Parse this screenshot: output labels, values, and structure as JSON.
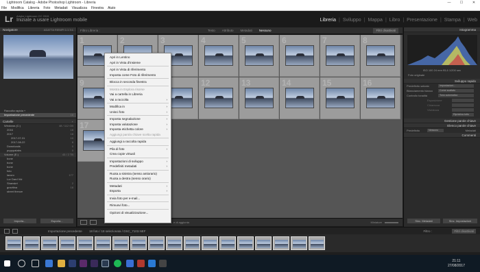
{
  "window": {
    "title": "Lightroom Catalog - Adobe Photoshop Lightroom - Libreria",
    "controls": [
      "—",
      "☐",
      "✕"
    ]
  },
  "menu": [
    "File",
    "Modifica",
    "Libreria",
    "Foto",
    "Metadati",
    "Visualizza",
    "Finestra",
    "Aiuto"
  ],
  "identity": {
    "logo": "Lr",
    "catalog": "Adobe Lightroom CC 2015",
    "subtitle": "Iniziate a usare Lightroom mobile"
  },
  "modules": [
    "Libreria",
    "Sviluppo",
    "Mappa",
    "Libro",
    "Presentazione",
    "Stampa",
    "Web"
  ],
  "left_panel": {
    "navigator_label": "Navigatore",
    "navigator_modes": "ADATTA  RIEMPI  1:1  3:1",
    "quick_collection": "Raccolta rapida +",
    "previous_import": "Importazione precedente",
    "previous_import_count": "18",
    "catalog_label": "Cartelle",
    "volume1": "Windows (C:)",
    "volume1_info": "48 / 112 GB",
    "tree": [
      {
        "label": "2016",
        "count": "18"
      },
      {
        "label": "2017",
        "count": "18"
      },
      {
        "label": "2017-07-31",
        "count": "10"
      },
      {
        "label": "2017-08-22",
        "count": "8"
      },
      {
        "label": "Downloads",
        "count": "0"
      },
      {
        "label": "pupppatabs",
        "count": "0"
      }
    ],
    "volume2": "Volume (E:)",
    "volume2_info": "43 / 2 TB",
    "tree2": [
      {
        "label": "bone",
        "count": ""
      },
      {
        "label": "bone",
        "count": ""
      },
      {
        "label": "bone",
        "count": ""
      },
      {
        "label": "foto",
        "count": ""
      },
      {
        "label": "lavoro",
        "count": "177"
      },
      {
        "label": "Lor Dard Vid",
        "count": ""
      },
      {
        "label": "Shanskrt",
        "count": "2"
      },
      {
        "label": "gravitina",
        "count": "18"
      },
      {
        "label": "street firenze",
        "count": ""
      }
    ],
    "import_btn": "Importa...",
    "export_btn": "Esporta..."
  },
  "filterbar": {
    "label": "Filtro Libreria :",
    "tabs": [
      "Testo",
      "Attributo",
      "Metadati",
      "Nessuno"
    ],
    "active_tab": "Nessuno",
    "preset": "Filtri disattivati"
  },
  "grid": {
    "row1": [
      "1",
      "2",
      "3",
      "4",
      "5",
      "6",
      "7",
      "8"
    ],
    "row2": [
      "9",
      "10",
      "11",
      "12",
      "13",
      "14",
      "15",
      "16"
    ],
    "row3": [
      "17"
    ]
  },
  "toolbar": {
    "sort": "Ordina: Ora di acquisizione",
    "thumbs": "Miniature",
    "note": "e di aggiunta"
  },
  "context_menu": [
    {
      "label": "Apri in Lentino",
      "type": "item"
    },
    {
      "label": "Apri in Vista d'insieme",
      "type": "item"
    },
    {
      "type": "sep"
    },
    {
      "label": "Apri in Vista di riferimento",
      "type": "item"
    },
    {
      "label": "Imposta come Foto di riferimento",
      "type": "item"
    },
    {
      "type": "sep"
    },
    {
      "label": "Blocca in seconda finestra",
      "type": "item"
    },
    {
      "type": "sep"
    },
    {
      "label": "Mostra in Esplora risorse",
      "type": "disabled"
    },
    {
      "label": "Vai a cartella in Libreria",
      "type": "item"
    },
    {
      "label": "Vai a raccolta",
      "type": "sub"
    },
    {
      "type": "sep"
    },
    {
      "label": "Modifica in",
      "type": "sub"
    },
    {
      "label": "Unisci foto",
      "type": "sub"
    },
    {
      "type": "sep"
    },
    {
      "label": "Imposta segnalazione",
      "type": "sub"
    },
    {
      "label": "Imposta valutazione",
      "type": "sub"
    },
    {
      "label": "Imposta etichetta colore",
      "type": "sub"
    },
    {
      "label": "Aggiungi parola chiave scelta rapida",
      "type": "disabled"
    },
    {
      "type": "sep"
    },
    {
      "label": "Aggiungi a raccolta rapida",
      "type": "item"
    },
    {
      "type": "sep"
    },
    {
      "label": "Pila di foto",
      "type": "sub"
    },
    {
      "label": "Crea copie virtuali",
      "type": "item"
    },
    {
      "type": "sep"
    },
    {
      "label": "Impostazioni di sviluppo",
      "type": "sub"
    },
    {
      "label": "Predefiniti metadati",
      "type": "sub"
    },
    {
      "type": "sep"
    },
    {
      "label": "Ruota a sinistra (senso antiorario)",
      "type": "item"
    },
    {
      "label": "Ruota a destra (senso orario)",
      "type": "item"
    },
    {
      "type": "sep"
    },
    {
      "label": "Metadati",
      "type": "sub"
    },
    {
      "label": "Esporta",
      "type": "sub"
    },
    {
      "type": "sep"
    },
    {
      "label": "Invia foto per e-mail...",
      "type": "item"
    },
    {
      "type": "sep"
    },
    {
      "label": "Rimuovi foto...",
      "type": "item"
    },
    {
      "type": "sep"
    },
    {
      "label": "Opzioni di visualizzazione...",
      "type": "item"
    }
  ],
  "right_panel": {
    "histogram_label": "Istogramma",
    "histo_info": "ISO 100   24 mm   f/5,6   1/200 sec",
    "original": "Foto originale",
    "quick_develop": "Sviluppo rapido",
    "preset_label": "Predefinito salvato",
    "preset_value": "Impostazioni...",
    "wb_label": "Bilanciamento bianco",
    "wb_value": "Come scattato",
    "tone_label": "Controllo tonalità",
    "tone_value": "Tono automatico",
    "rows": [
      "Esposizione",
      "Chiarezza",
      "Vividezza"
    ],
    "reset_btn": "Ripristina tutto",
    "keywording": "Gestione parole chiave",
    "keyword_list": "Elenco parole chiave",
    "metadata": "Metadati",
    "metadata_preset": "Predefinito",
    "metadata_value": "Nessuno",
    "comments": "Commenti",
    "sync_btn": "Sinc. Metadati",
    "sync_settings_btn": "Sinc. Impostazioni"
  },
  "filmstrip": {
    "header_left": "Importazione precedente",
    "header_count": "18 foto / 18 selezionata / DSC_7103.NEF",
    "filter_label": "Filtro :",
    "filter_value": "Filtri disattivati"
  },
  "taskbar": {
    "time": "21:11",
    "date": "27/08/2017"
  }
}
